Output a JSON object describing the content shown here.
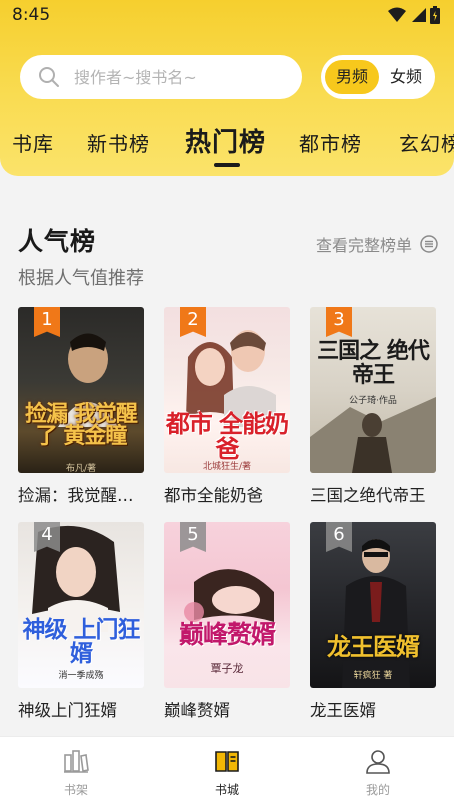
{
  "status_bar": {
    "time": "8:45"
  },
  "search": {
    "placeholder": "搜作者~搜书名~"
  },
  "gender_toggle": {
    "male": "男频",
    "female": "女频",
    "selected": "男频"
  },
  "tabs": [
    {
      "label": "书库"
    },
    {
      "label": "新书榜"
    },
    {
      "label": "热门榜",
      "active": true
    },
    {
      "label": "都市榜"
    },
    {
      "label": "玄幻榜"
    }
  ],
  "section": {
    "title": "人气榜",
    "subtitle": "根据人气值推荐",
    "more": "查看完整榜单"
  },
  "books": [
    {
      "rank": "1",
      "name": "捡漏：我觉醒了黄金瞳",
      "cover_title": "捡漏 我觉醒了 黄金瞳",
      "cover_author": "布凡/著"
    },
    {
      "rank": "2",
      "name": "都市全能奶爸",
      "cover_title": "都市 全能奶爸",
      "cover_author": "北城狂生/著"
    },
    {
      "rank": "3",
      "name": "三国之绝代帝王",
      "cover_title": "三国之 绝代帝王",
      "cover_author": "公子琦·作品"
    },
    {
      "rank": "4",
      "name": "神级上门狂婿",
      "cover_title": "神级 上门狂婿",
      "cover_author": "消一季成殇"
    },
    {
      "rank": "5",
      "name": "巅峰赘婿",
      "cover_title": "巅峰赘婿",
      "cover_author": "覃子龙"
    },
    {
      "rank": "6",
      "name": "龙王医婿",
      "cover_title": "龙王医婿",
      "cover_author": "轩疯狂 著"
    }
  ],
  "bottom_nav": [
    {
      "label": "书架",
      "icon": "bookshelf-icon"
    },
    {
      "label": "书城",
      "icon": "bookstore-icon",
      "active": true
    },
    {
      "label": "我的",
      "icon": "profile-icon"
    }
  ],
  "colors": {
    "header_yellow": "#f9dc52",
    "accent_yellow": "#f7c81c",
    "rank_orange": "#f07818"
  }
}
